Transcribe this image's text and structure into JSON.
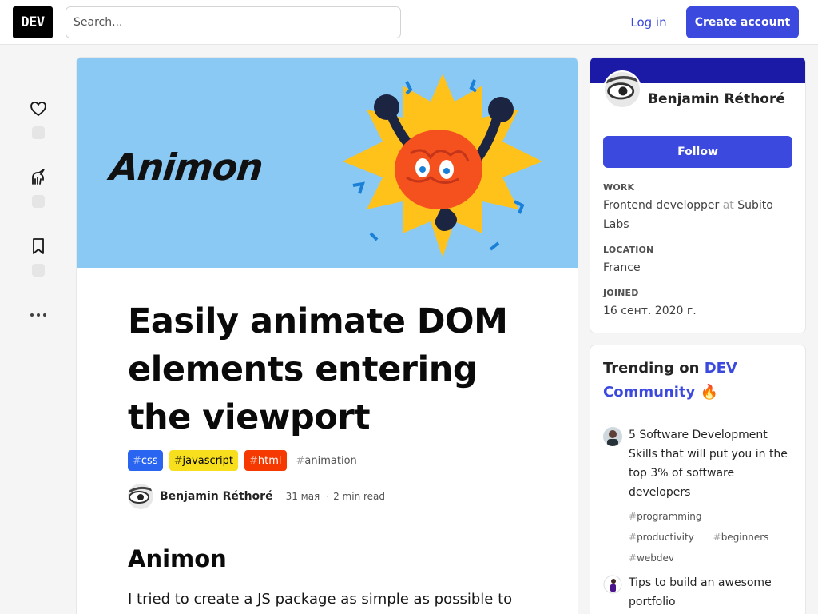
{
  "header": {
    "logo_text": "DEV",
    "search_placeholder": "Search...",
    "login_label": "Log in",
    "create_account_label": "Create account",
    "accent_color": "#3b49df"
  },
  "reactions": {
    "items": [
      {
        "icon": "heart-icon",
        "count": ""
      },
      {
        "icon": "unicorn-icon",
        "count": ""
      },
      {
        "icon": "bookmark-icon",
        "count": ""
      }
    ],
    "more_icon": "ellipsis-icon"
  },
  "article": {
    "cover_text": "Animon",
    "title": "Easily animate DOM elements entering the viewport",
    "tags": [
      {
        "hash": "#",
        "name": "css",
        "color": "#2965f1"
      },
      {
        "hash": "#",
        "name": "javascript",
        "color": "#f7df1e"
      },
      {
        "hash": "#",
        "name": "html",
        "color": "#f53900"
      },
      {
        "hash": "#",
        "name": "animation",
        "color": ""
      }
    ],
    "author": "Benjamin Réthoré",
    "date": "31 мая",
    "separator": "·",
    "read_time": "2 min read",
    "heading": "Animon",
    "body_first_line": "I tried to create a JS package as simple as possible to"
  },
  "profile": {
    "name": "Benjamin Réthoré",
    "follow_label": "Follow",
    "work_label": "Work",
    "work_role": "Frontend developper",
    "work_at": "at",
    "work_company": "Subito Labs",
    "location_label": "Location",
    "location": "France",
    "joined_label": "Joined",
    "joined": "16 сент. 2020 г.",
    "band_color": "#1a1aa6"
  },
  "trending": {
    "heading_prefix": "Trending on",
    "heading_dev": "DEV Community",
    "heading_emoji": "🔥",
    "items": [
      {
        "title": "5 Software Development Skills that will put you in the top 3% of software developers",
        "tags": [
          "programming",
          "productivity",
          "beginners",
          "webdev"
        ]
      },
      {
        "title": "Tips to build an awesome portfolio",
        "tags": []
      }
    ]
  }
}
